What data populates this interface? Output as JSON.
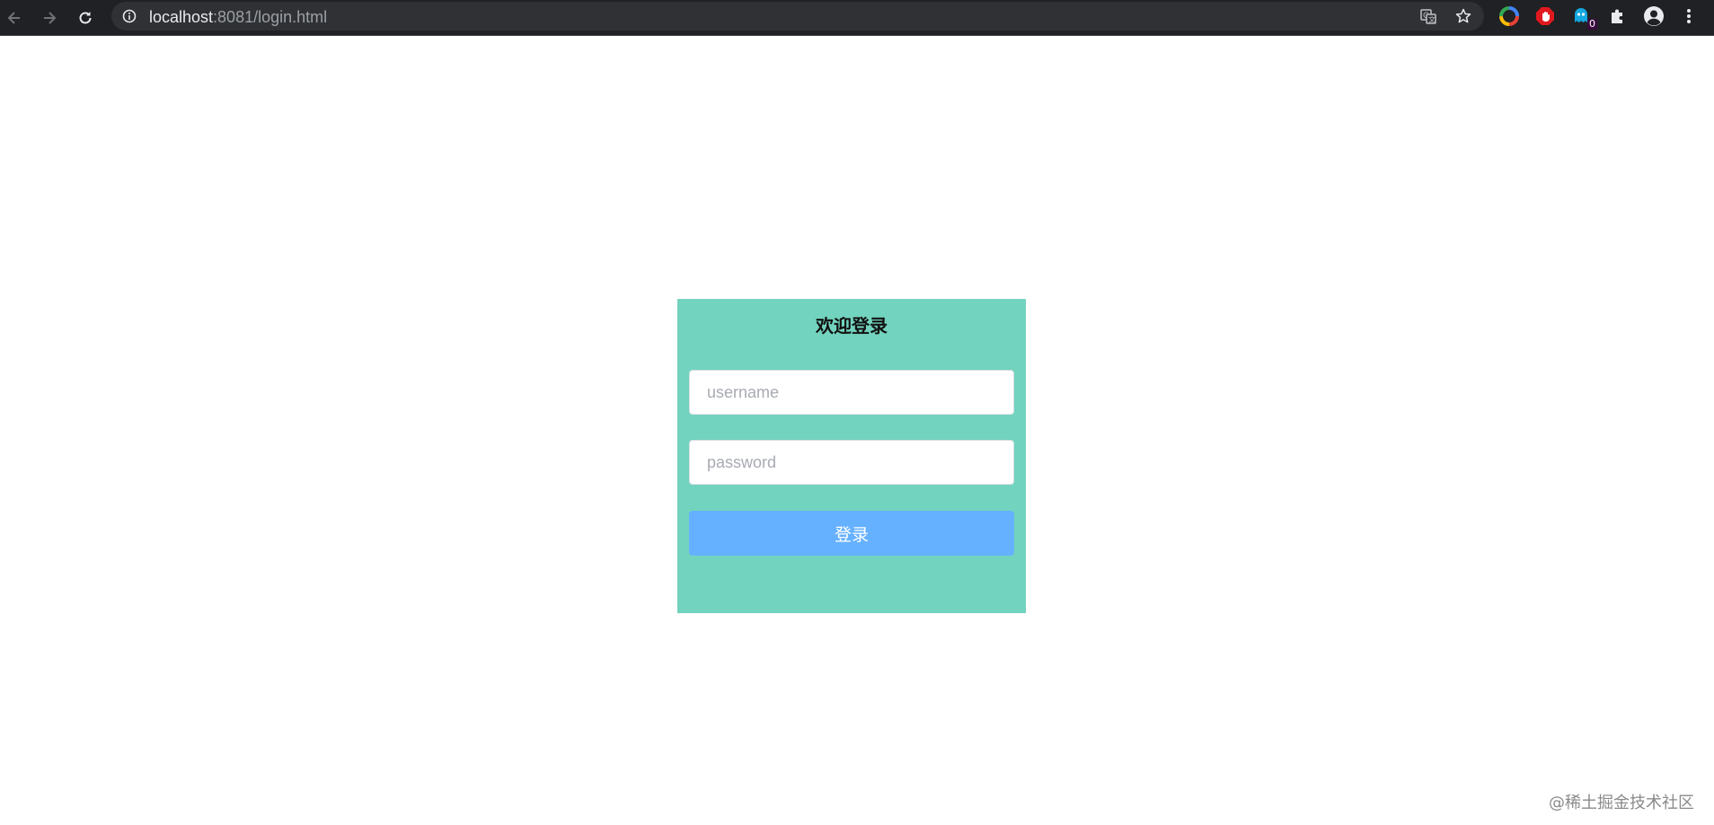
{
  "browser": {
    "url_host": "localhost",
    "url_rest": ":8081/login.html",
    "icons": {
      "back": "arrow-left-icon",
      "forward": "arrow-right-icon",
      "reload": "reload-icon",
      "site_info": "info-icon",
      "translate": "translate-icon",
      "bookmark": "star-icon",
      "extension_1": "color-wheel-extension-icon",
      "extension_2": "stop-hand-extension-icon",
      "extension_3": "ghost-extension-icon",
      "extensions": "puzzle-icon",
      "profile": "account-circle-icon",
      "menu": "kebab-menu-icon"
    },
    "extension_badge": "0"
  },
  "login": {
    "title": "欢迎登录",
    "username_placeholder": "username",
    "password_placeholder": "password",
    "submit_label": "登录"
  },
  "watermark": "@稀土掘金技术社区",
  "colors": {
    "panel_bg": "#72d3be",
    "button_bg": "#66b1ff",
    "toolbar_bg": "#202124"
  }
}
